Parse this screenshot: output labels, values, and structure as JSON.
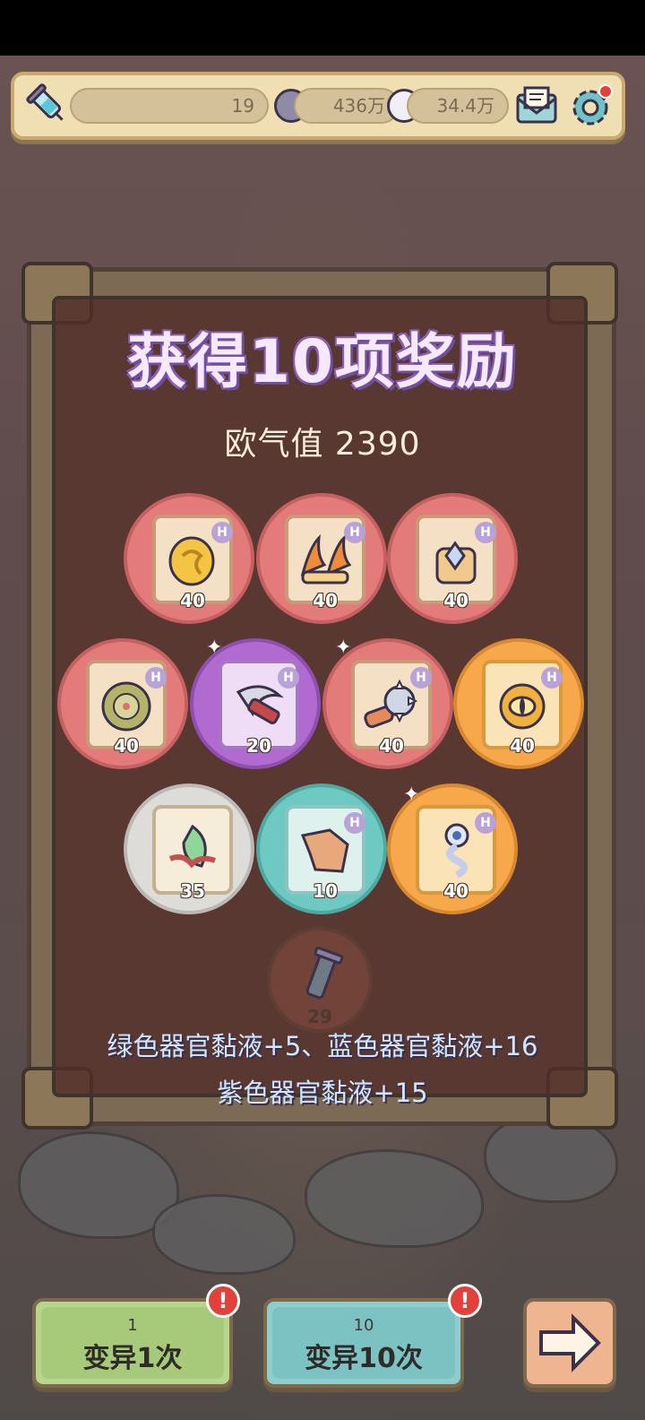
{
  "topbar": {
    "syringe_icon": "syringe-icon",
    "energy_value": "19",
    "currency1_value": "436万",
    "currency2_value": "34.4万",
    "mail_icon": "mail-icon",
    "settings_icon": "gear-icon"
  },
  "reward": {
    "title": "获得10项奖励",
    "luck_label": "欧气值 2390",
    "items": [
      {
        "count": "40",
        "rarity": "red",
        "badge": "H",
        "icon": "gold-coin-icon"
      },
      {
        "count": "40",
        "rarity": "red",
        "badge": "H",
        "icon": "claw-icon"
      },
      {
        "count": "40",
        "rarity": "red",
        "badge": "H",
        "icon": "crystal-stump-icon"
      },
      {
        "count": "40",
        "rarity": "red",
        "badge": "H",
        "icon": "green-disc-icon"
      },
      {
        "count": "20",
        "rarity": "purple",
        "badge": "H",
        "icon": "scythe-icon"
      },
      {
        "count": "40",
        "rarity": "red",
        "badge": "H",
        "icon": "spiked-mace-icon"
      },
      {
        "count": "40",
        "rarity": "orange",
        "badge": "H",
        "icon": "golden-eye-icon"
      },
      {
        "count": "35",
        "rarity": "grey",
        "badge": "",
        "icon": "green-leaf-icon"
      },
      {
        "count": "10",
        "rarity": "teal",
        "badge": "H",
        "icon": "parchment-icon"
      },
      {
        "count": "40",
        "rarity": "orange",
        "badge": "H",
        "icon": "eye-worm-icon"
      }
    ],
    "slot_count": "29",
    "bonus_line1": "绿色器官黏液+5、蓝色器官黏液+16",
    "bonus_line2": "紫色器官黏液+15"
  },
  "buttons": {
    "mutate_once": {
      "count": "1",
      "label": "变异1次",
      "alert": "!"
    },
    "mutate_ten": {
      "count": "10",
      "label": "变异10次",
      "alert": "!"
    },
    "next_icon": "arrow-right-icon"
  },
  "colors": {
    "red": "#e47b7b",
    "purple": "#b06ad0",
    "orange": "#f6a84a",
    "grey": "#dedcd8",
    "teal": "#6fc9c3",
    "title_outline": "#6b4f9b"
  }
}
